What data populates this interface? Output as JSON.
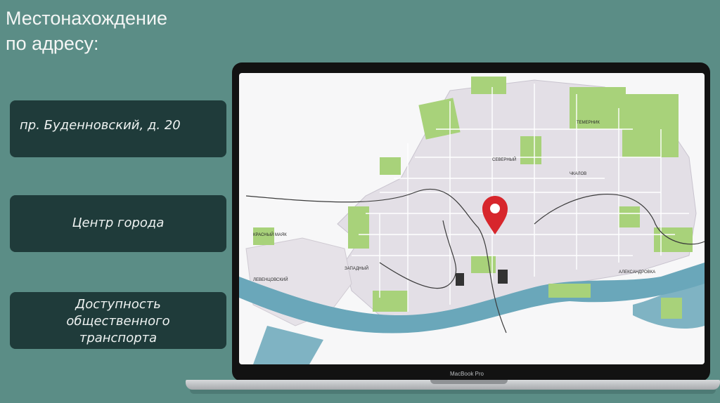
{
  "title": {
    "line1": "Местонахождение",
    "line2": "по адресу:"
  },
  "cards": {
    "address": "пр. Буденновский, д. 20",
    "center": "Центр города",
    "transport_line1": "Доступность",
    "transport_line2": "общественного",
    "transport_line3": "транспорта"
  },
  "laptop": {
    "model": "MacBook Pro"
  },
  "map": {
    "pin_color": "#d7262c",
    "park_color": "#a8d27a",
    "water_color": "#6aa7ba",
    "labels": {
      "l1": "КРАСНЫЙ МАЯК",
      "l2": "СЕВЕРНЫЙ",
      "l3": "ЗАПАДНЫЙ",
      "l4": "АЛЕКСАНДРОВКА",
      "l5": "ЛЕВЕНЦОВСКИЙ",
      "l6": "ЧКАЛОВ",
      "l7": "ТЕМЕРНИК"
    }
  },
  "colors": {
    "background": "#5b8d86",
    "card": "#1f3b3a"
  }
}
